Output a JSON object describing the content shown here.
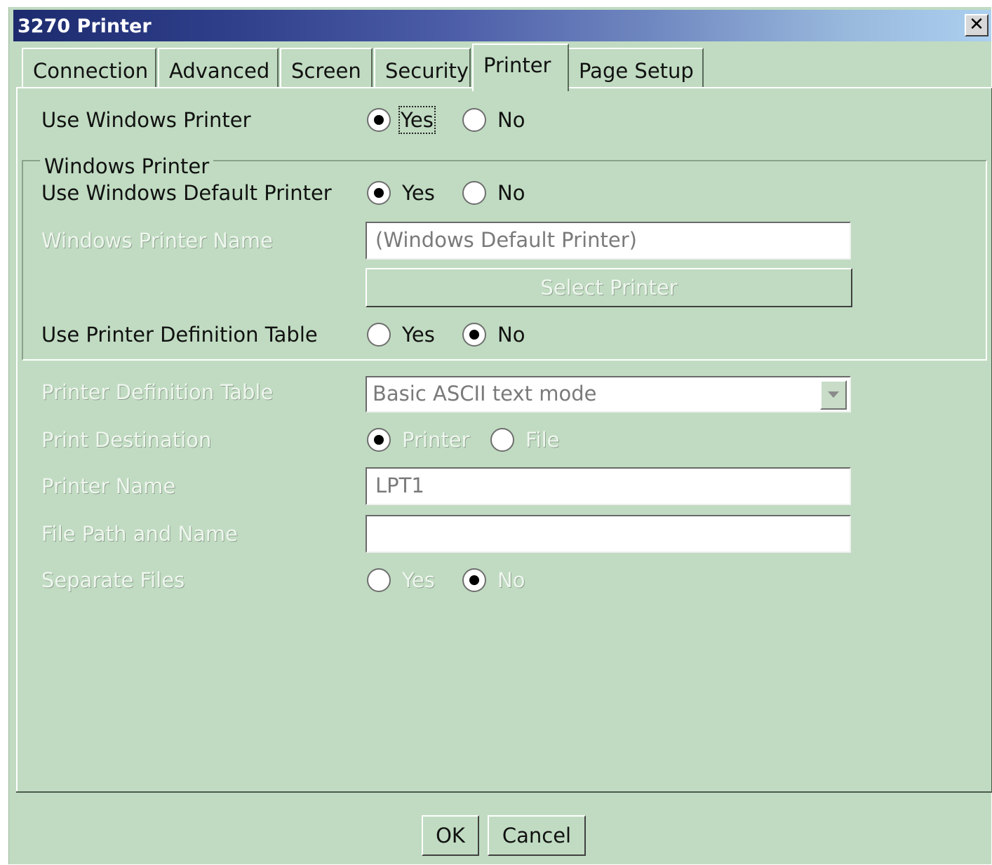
{
  "window": {
    "title": "3270 Printer",
    "close_label": "✕"
  },
  "tabs": [
    "Connection",
    "Advanced",
    "Screen",
    "Security",
    "Printer",
    "Page Setup"
  ],
  "use_windows_printer": {
    "label": "Use Windows Printer",
    "yes": "Yes",
    "no": "No",
    "selected": "yes"
  },
  "windows_printer_group": {
    "title": "Windows Printer",
    "use_default": {
      "label": "Use Windows Default Printer",
      "yes": "Yes",
      "no": "No",
      "selected": "yes"
    },
    "printer_name": {
      "label": "Windows Printer Name",
      "value": "(Windows Default Printer)"
    },
    "select_button": "Select Printer",
    "use_pdt": {
      "label": "Use Printer Definition Table",
      "yes": "Yes",
      "no": "No",
      "selected": "no"
    }
  },
  "pdt": {
    "label": "Printer Definition Table",
    "value": "Basic ASCII text mode"
  },
  "print_destination": {
    "label": "Print Destination",
    "printer": "Printer",
    "file": "File",
    "selected": "printer"
  },
  "printer_name": {
    "label": "Printer Name",
    "value": "LPT1"
  },
  "file_path": {
    "label": "File Path and Name",
    "value": ""
  },
  "separate_files": {
    "label": "Separate Files",
    "yes": "Yes",
    "no": "No",
    "selected": "no"
  },
  "buttons": {
    "ok": "OK",
    "cancel": "Cancel"
  }
}
